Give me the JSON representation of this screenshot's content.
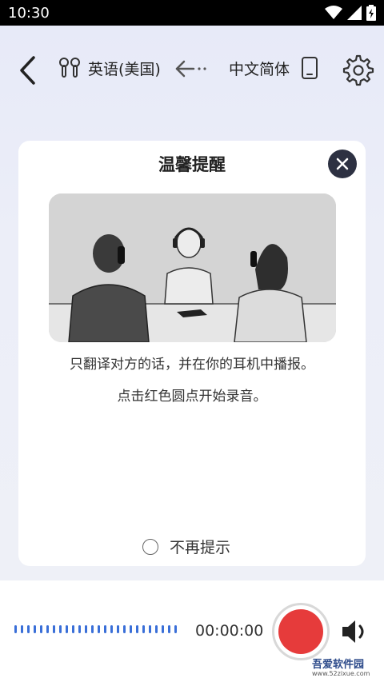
{
  "status_bar": {
    "time": "10:30"
  },
  "header": {
    "source_language": "英语(美国)",
    "target_language": "中文简体"
  },
  "dialog": {
    "title": "温馨提醒",
    "message_line1": "只翻译对方的话，并在你的耳机中播报。",
    "message_line2": "点击红色圆点开始录音。",
    "dont_remind_label": "不再提示"
  },
  "recorder": {
    "elapsed_time": "00:00:00",
    "record_color": "#e63b3b"
  },
  "watermark": {
    "text": "吾爱软件园",
    "url": "www.52zixue.com"
  },
  "colors": {
    "accent_blue": "#3a6fd8",
    "dark": "#2d3142"
  }
}
